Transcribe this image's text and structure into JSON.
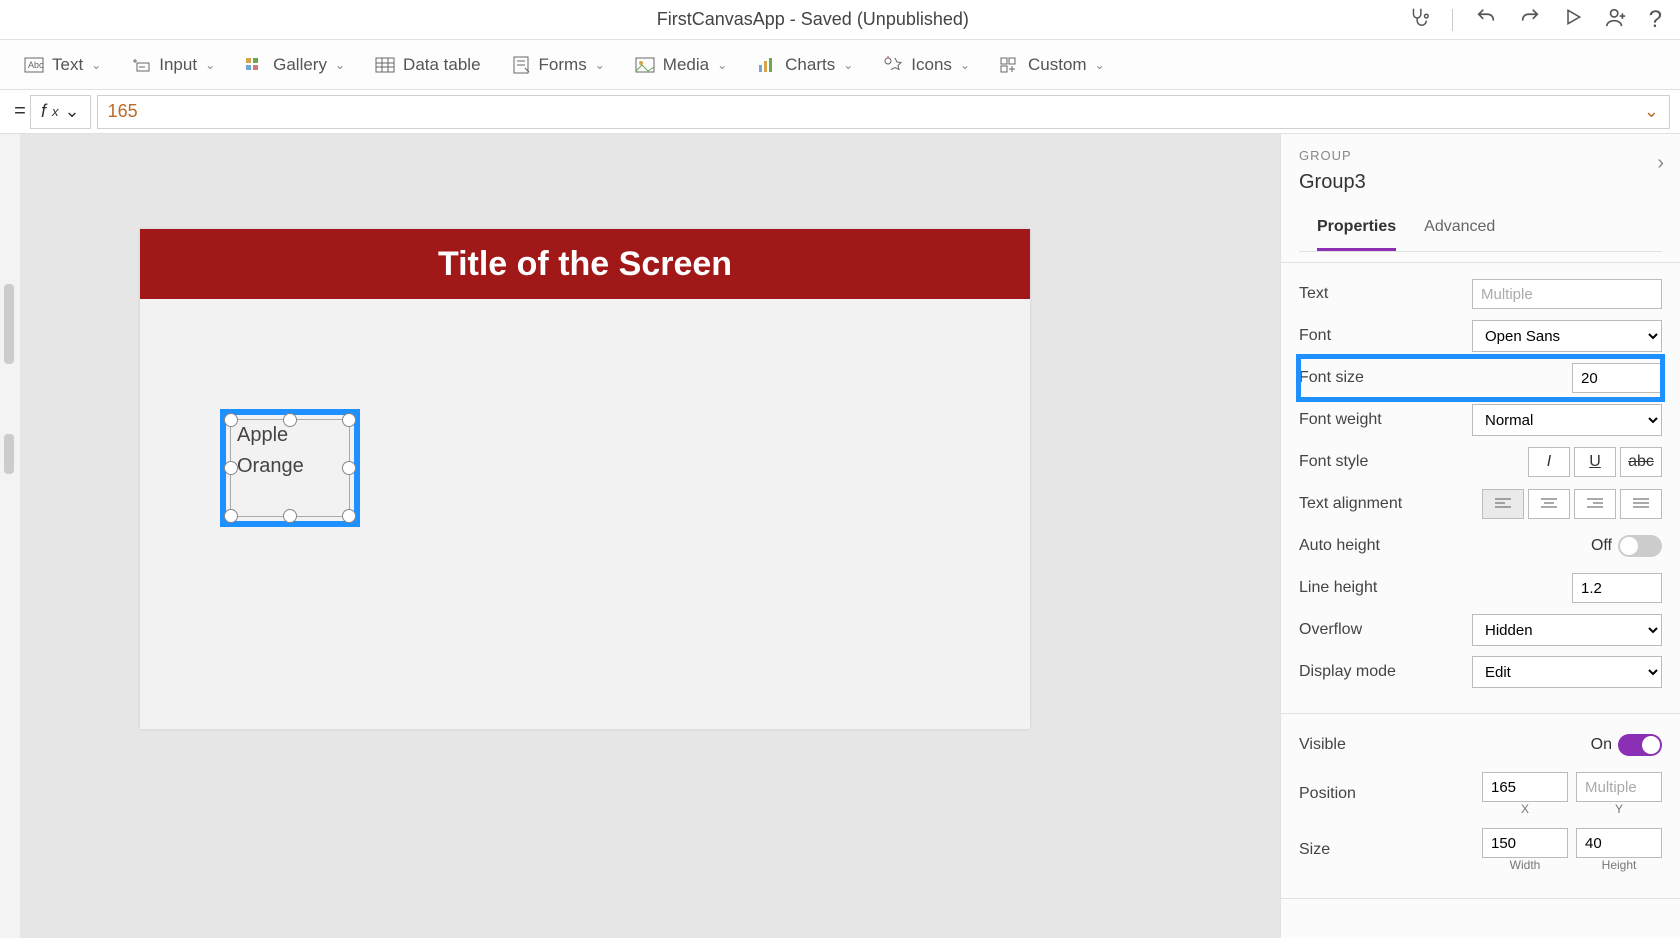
{
  "titlebar": {
    "app_title": "FirstCanvasApp - Saved (Unpublished)"
  },
  "ribbon": {
    "text": "Text",
    "input": "Input",
    "gallery": "Gallery",
    "data_table": "Data table",
    "forms": "Forms",
    "media": "Media",
    "charts": "Charts",
    "icons": "Icons",
    "custom": "Custom"
  },
  "formula": {
    "value": "165"
  },
  "canvas": {
    "title": "Title of the Screen",
    "group_items": [
      "Apple",
      "Orange"
    ]
  },
  "props": {
    "type_label": "GROUP",
    "name": "Group3",
    "tabs": {
      "properties": "Properties",
      "advanced": "Advanced"
    },
    "text_label": "Text",
    "text_value": "Multiple",
    "font_label": "Font",
    "font_value": "Open Sans",
    "fontsize_label": "Font size",
    "fontsize_value": "20",
    "fontweight_label": "Font weight",
    "fontweight_value": "Normal",
    "fontstyle_label": "Font style",
    "textalign_label": "Text alignment",
    "autoheight_label": "Auto height",
    "autoheight_value": "Off",
    "lineheight_label": "Line height",
    "lineheight_value": "1.2",
    "overflow_label": "Overflow",
    "overflow_value": "Hidden",
    "displaymode_label": "Display mode",
    "displaymode_value": "Edit",
    "visible_label": "Visible",
    "visible_value": "On",
    "position_label": "Position",
    "position_x": "165",
    "position_y": "Multiple",
    "pos_x_sub": "X",
    "pos_y_sub": "Y",
    "size_label": "Size",
    "size_w": "150",
    "size_h": "40",
    "size_w_sub": "Width",
    "size_h_sub": "Height"
  }
}
